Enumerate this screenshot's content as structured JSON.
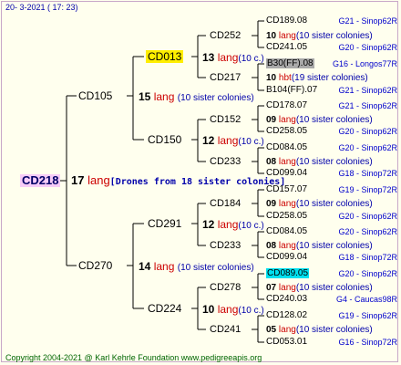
{
  "header": {
    "date": "20-  3-2021 ( 17: 23)"
  },
  "footer": {
    "copyright": "Copyright 2004-2021 @ Karl Kehrle Foundation    www.pedigreeapis.org"
  },
  "root": {
    "id": "CD218",
    "count": "17",
    "lang": "lang",
    "note": "[Drones from 18 sister colonies]"
  },
  "gen1": [
    {
      "id": "CD105",
      "count": "15",
      "lang": "lang",
      "note": "(10 sister colonies)"
    },
    {
      "id": "CD270",
      "count": "14",
      "lang": "lang",
      "note": "(10 sister colonies)"
    }
  ],
  "gen2": [
    {
      "id": "CD013",
      "count": "13",
      "lang": "lang",
      "note": "(10 c.)"
    },
    {
      "id": "CD150",
      "count": "12",
      "lang": "lang",
      "note": "(10 c.)"
    },
    {
      "id": "CD291",
      "count": "12",
      "lang": "lang",
      "note": "(10 c.)"
    },
    {
      "id": "CD224",
      "count": "10",
      "lang": "lang",
      "note": "(10 c.)"
    }
  ],
  "gen3": [
    {
      "id": "CD252",
      "count": "10",
      "lang": "lang",
      "note": "(10 sister colonies)"
    },
    {
      "id": "CD217",
      "count": "10",
      "lang": "hbt",
      "note": "(19 sister colonies)"
    },
    {
      "id": "CD152",
      "count": "09",
      "lang": "lang",
      "note": "(10 sister colonies)"
    },
    {
      "id": "CD233",
      "count": "08",
      "lang": "lang",
      "note": "(10 sister colonies)"
    },
    {
      "id": "CD184",
      "count": "09",
      "lang": "lang",
      "note": "(10 sister colonies)"
    },
    {
      "id": "CD233",
      "count": "08",
      "lang": "lang",
      "note": "(10 sister colonies)"
    },
    {
      "id": "CD278",
      "count": "07",
      "lang": "lang",
      "note": "(10 sister colonies)"
    },
    {
      "id": "CD241",
      "count": "05",
      "lang": "lang",
      "note": "(10 sister colonies)"
    }
  ],
  "gen4": [
    {
      "id": "CD189.08",
      "info": "G21 - Sinop62R"
    },
    {
      "id": "CD241.05",
      "info": "G20 - Sinop62R"
    },
    {
      "id": "B30(FF).08",
      "info": "G16 - Longos77R"
    },
    {
      "id": "B104(FF).07",
      "info": "G21 - Sinop62R"
    },
    {
      "id": "CD178.07",
      "info": "G21 - Sinop62R"
    },
    {
      "id": "CD258.05",
      "info": "G20 - Sinop62R"
    },
    {
      "id": "CD084.05",
      "info": "G20 - Sinop62R"
    },
    {
      "id": "CD099.04",
      "info": "G18 - Sinop72R"
    },
    {
      "id": "CD157.07",
      "info": "G19 - Sinop72R"
    },
    {
      "id": "CD258.05",
      "info": "G20 - Sinop62R"
    },
    {
      "id": "CD084.05",
      "info": "G20 - Sinop62R"
    },
    {
      "id": "CD099.04",
      "info": "G18 - Sinop72R"
    },
    {
      "id": "CD089.05",
      "info": "G20 - Sinop62R"
    },
    {
      "id": "CD240.03",
      "info": "G4 - Caucas98R"
    },
    {
      "id": "CD128.02",
      "info": "G19 - Sinop62R"
    },
    {
      "id": "CD053.01",
      "info": "G16 - Sinop72R"
    }
  ]
}
